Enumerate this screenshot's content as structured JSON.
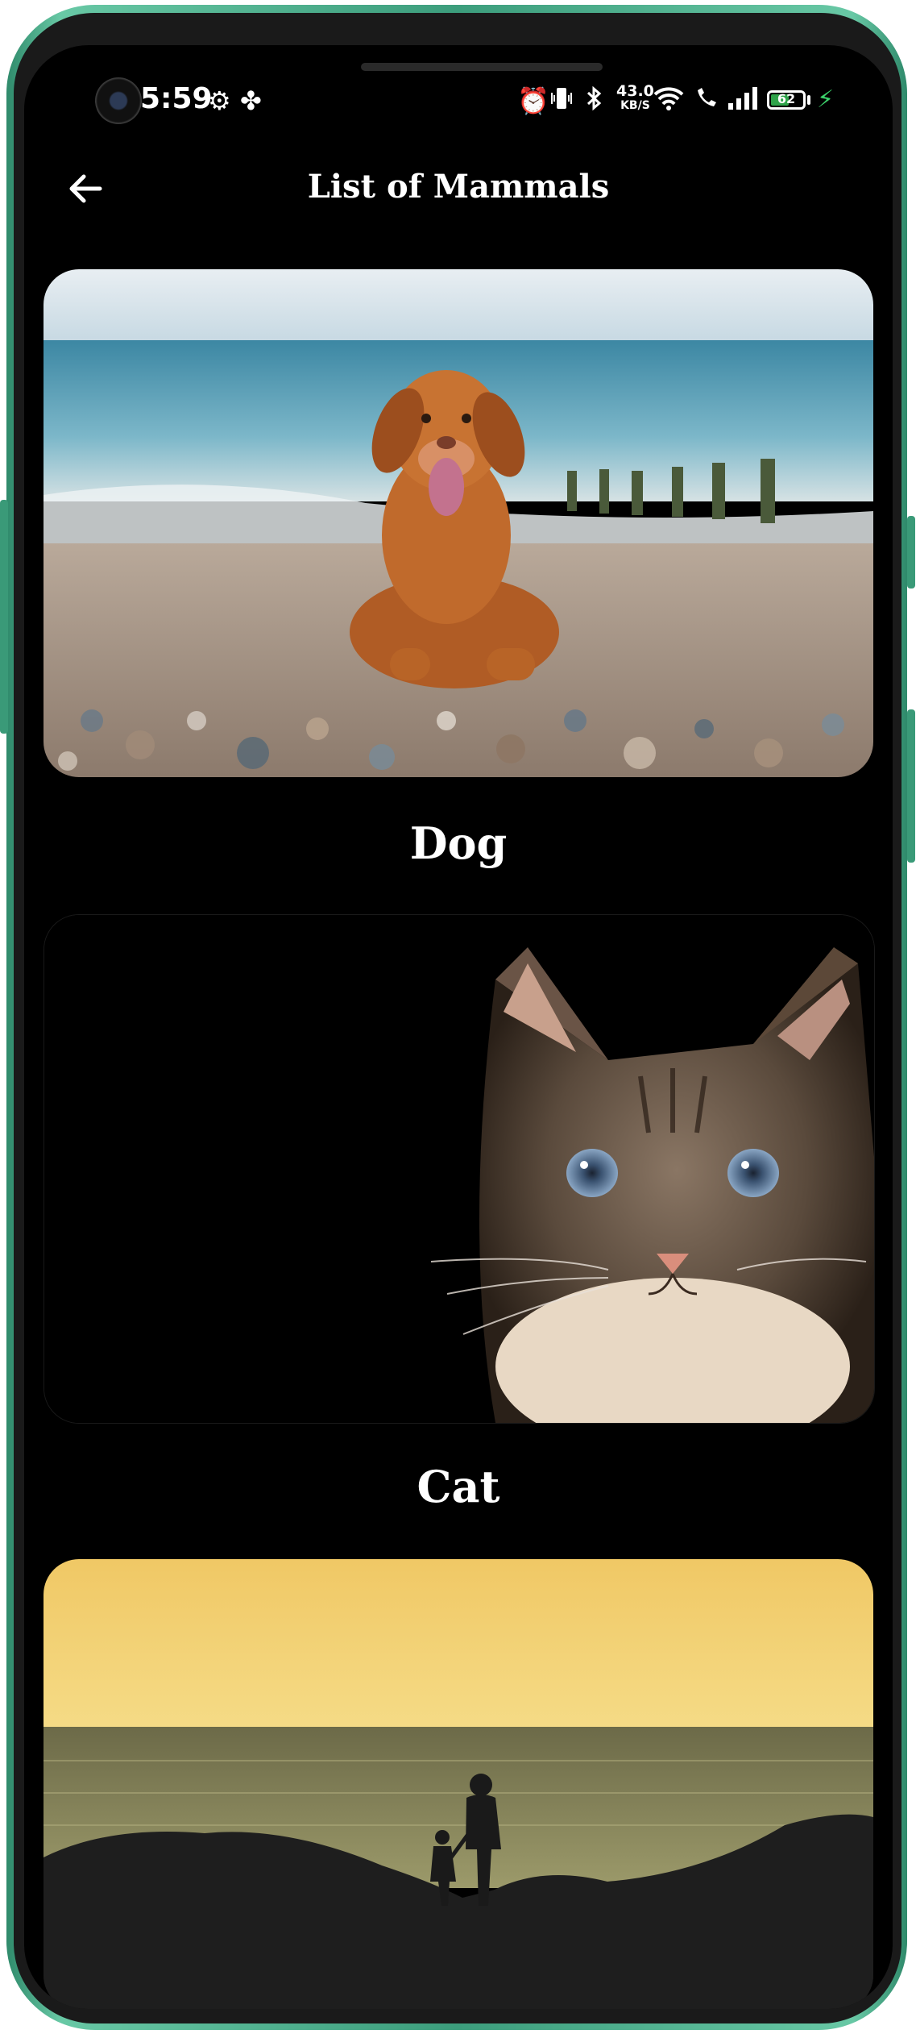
{
  "status_bar": {
    "time": "5:59",
    "network_speed_value": "43.0",
    "network_speed_unit": "KB/S",
    "battery_level": "62",
    "battery_fraction": 0.62
  },
  "app_bar": {
    "title": "List of Mammals"
  },
  "mammals": [
    {
      "name": "Dog"
    },
    {
      "name": "Cat"
    }
  ],
  "colors": {
    "background": "#000000",
    "frame_accent": "#3c9d7c",
    "battery_fill": "#2fa34a"
  }
}
